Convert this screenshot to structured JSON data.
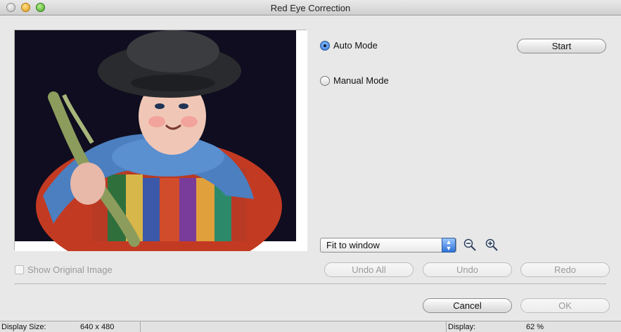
{
  "window": {
    "title": "Red Eye Correction"
  },
  "modes": {
    "auto_label": "Auto Mode",
    "manual_label": "Manual Mode",
    "selected": "auto"
  },
  "buttons": {
    "start": "Start",
    "undo_all": "Undo All",
    "undo": "Undo",
    "redo": "Redo",
    "cancel": "Cancel",
    "ok": "OK"
  },
  "zoom": {
    "selected_option": "Fit to window",
    "zoom_out_icon": "zoom-out-icon",
    "zoom_in_icon": "zoom-in-icon"
  },
  "options": {
    "show_original_label": "Show Original Image",
    "show_original_checked": false
  },
  "status": {
    "display_size_label": "Display Size:",
    "display_size_value": "640 x 480",
    "display_label": "Display:",
    "display_value": "62 %"
  }
}
